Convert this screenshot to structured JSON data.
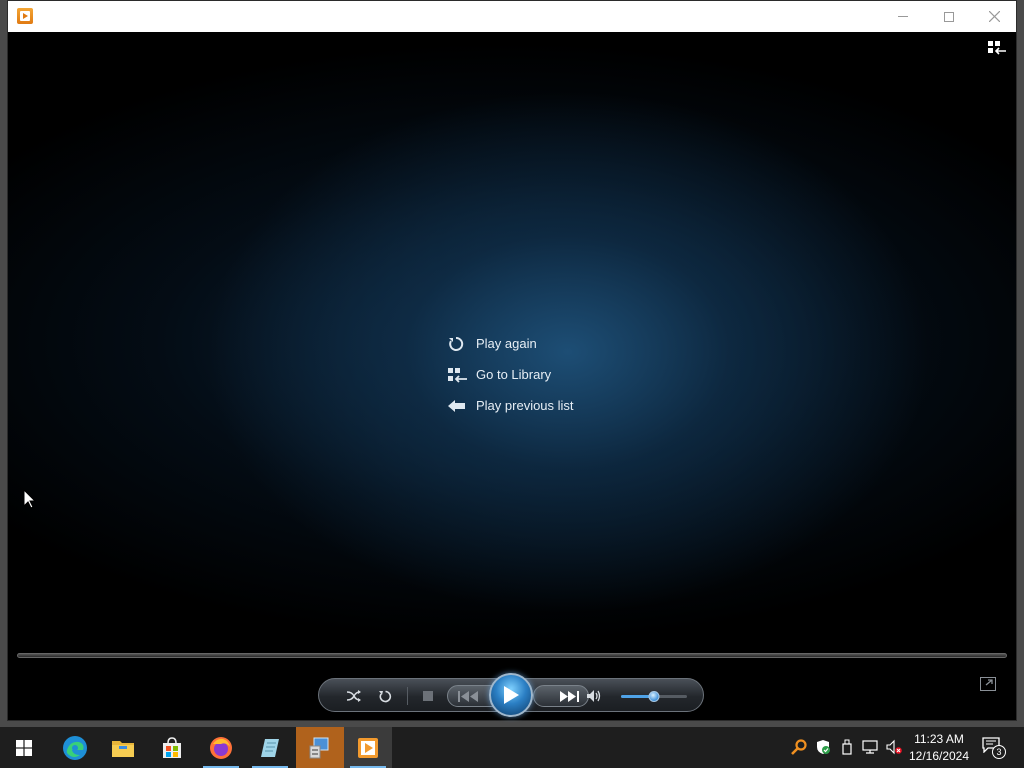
{
  "window": {
    "title": ""
  },
  "end_menu": {
    "items": [
      {
        "label": "Play again",
        "icon": "replay-icon"
      },
      {
        "label": "Go to Library",
        "icon": "library-icon"
      },
      {
        "label": "Play previous list",
        "icon": "back-arrow-icon"
      }
    ]
  },
  "player": {
    "volume_level": 0.5,
    "seek_progress": 0.0
  },
  "taskbar": {
    "apps": [
      "start",
      "edge",
      "file-explorer",
      "microsoft-store",
      "firefox",
      "notepad",
      "control-panel",
      "windows-media-player"
    ],
    "time": "11:23 AM",
    "date": "12/16/2024",
    "notification_count": "3"
  },
  "colors": {
    "accent": "#2b7fc4",
    "video_glow": "#1e5078",
    "taskbar_active": "#b0621c"
  }
}
